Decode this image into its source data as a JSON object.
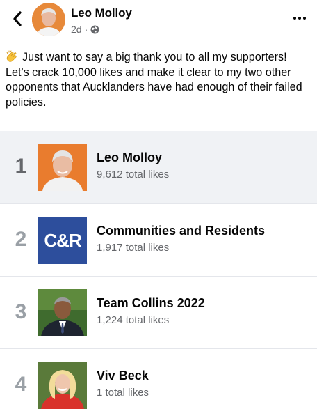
{
  "post": {
    "author": "Leo Molloy",
    "time": "2d",
    "separator": "·",
    "text": "Just want to say a big thank you to all my supporters! Let's crack 10,000 likes and make it clear to my two other opponents that Aucklanders have had enough of their failed policies."
  },
  "rankings": [
    {
      "rank": "1",
      "name": "Leo Molloy",
      "likes": "9,612 total likes"
    },
    {
      "rank": "2",
      "name": "Communities and Residents",
      "likes": "1,917 total likes",
      "logo_text": "C&R"
    },
    {
      "rank": "3",
      "name": "Team Collins 2022",
      "likes": "1,224 total likes"
    },
    {
      "rank": "4",
      "name": "Viv Beck",
      "likes": "1 total likes"
    }
  ],
  "colors": {
    "cr_logo_bg": "#2d4e9c",
    "highlight_row": "#f0f2f5"
  }
}
